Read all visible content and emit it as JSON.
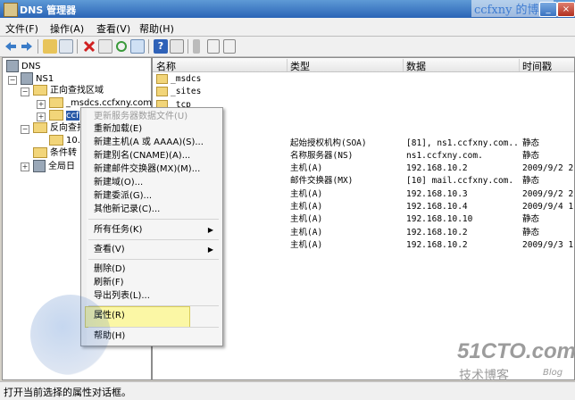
{
  "window": {
    "title": "DNS 管理器",
    "watermark_top": "ccfxny 的博客"
  },
  "menubar": [
    "文件(F)",
    "操作(A)",
    "查看(V)",
    "帮助(H)"
  ],
  "tree": {
    "root": "DNS",
    "server": "NS1",
    "forward_zones": "正向查找区域",
    "msdcs_zone": "_msdcs.ccfxny.com",
    "selected_zone": "ccf",
    "reverse_zones": "反向查找",
    "reverse_zone_item": "10.",
    "conditional": "条件转",
    "global_log": "全局日"
  },
  "list": {
    "columns": [
      "名称",
      "类型",
      "数据",
      "时间戳"
    ],
    "rows": [
      {
        "name": "_msdcs",
        "type": "",
        "data": "",
        "time": ""
      },
      {
        "name": "_sites",
        "type": "",
        "data": "",
        "time": ""
      },
      {
        "name": "_tcp",
        "type": "",
        "data": "",
        "time": ""
      },
      {
        "name": "es",
        "type": "",
        "data": "",
        "time": ""
      },
      {
        "name": "es",
        "type": "",
        "data": "",
        "time": ""
      },
      {
        "name": "同)",
        "type": "起始授权机构(SOA)",
        "data": "[81], ns1.ccfxny.com....",
        "time": "静态"
      },
      {
        "name": "同)",
        "type": "名称服务器(NS)",
        "data": "ns1.ccfxny.com.",
        "time": "静态"
      },
      {
        "name": "同)",
        "type": "主机(A)",
        "data": "192.168.10.2",
        "time": "2009/9/2 2"
      },
      {
        "name": "同)",
        "type": "邮件交换器(MX)",
        "data": "[10]  mail.ccfxny.com.",
        "time": "静态"
      },
      {
        "name": "",
        "type": "主机(A)",
        "data": "192.168.10.3",
        "time": "2009/9/2 2"
      },
      {
        "name": "",
        "type": "主机(A)",
        "data": "192.168.10.4",
        "time": "2009/9/4 1"
      },
      {
        "name": "",
        "type": "主机(A)",
        "data": "192.168.10.10",
        "time": "静态"
      },
      {
        "name": "",
        "type": "主机(A)",
        "data": "192.168.10.2",
        "time": "静态"
      },
      {
        "name": "_JP",
        "type": "主机(A)",
        "data": "192.168.10.2",
        "time": "2009/9/3 1"
      }
    ]
  },
  "context_menu": {
    "update_server_data": "更新服务器数据文件(U)",
    "reload": "重新加载(E)",
    "new_host": "新建主机(A 或 AAAA)(S)...",
    "new_alias": "新建别名(CNAME)(A)...",
    "new_mx": "新建邮件交换器(MX)(M)...",
    "new_domain": "新建域(O)...",
    "new_delegation": "新建委派(G)...",
    "other_records": "其他新记录(C)...",
    "all_tasks": "所有任务(K)",
    "view": "查看(V)",
    "delete": "删除(D)",
    "refresh": "刷新(F)",
    "export_list": "导出列表(L)...",
    "properties": "属性(R)",
    "help": "帮助(H)"
  },
  "status": "打开当前选择的属性对话框。",
  "watermark": {
    "site": "51CTO.com",
    "sub": "技术博客",
    "blog": "Blog"
  }
}
